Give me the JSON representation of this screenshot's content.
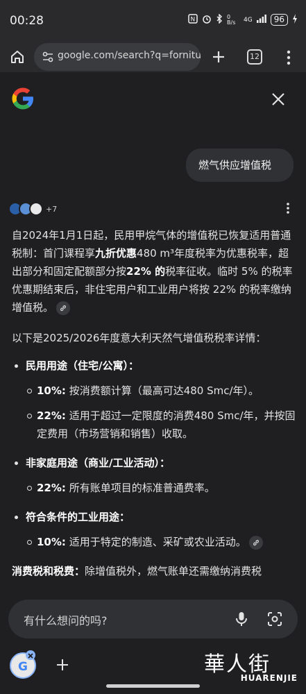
{
  "status_bar": {
    "time": "00:28",
    "net_label": "0 B/s",
    "signal": "4G",
    "battery": "96"
  },
  "browser": {
    "url": "google.com/search?q=fornitura",
    "tab_count": "12"
  },
  "query": "燃气供应增值税",
  "sources": {
    "more_count": "+7"
  },
  "answer": {
    "p1_a": "自2024年1月1日起，民用甲烷气体的增值税已恢复适用普通税制：首门课程享",
    "p1_b": "九折优惠",
    "p1_c": "480 m³年度税率为优惠税率，超出部分和固定配额部分按",
    "p1_d": "22% 的",
    "p1_e": "税率征收。临时 5% 的税率优惠期结束后，非住宅用户和工业用户将按 22% 的税率缴纳增值税。",
    "p2": "以下是2025/2026年度意大利天然气增值税税率详情：",
    "groups": [
      {
        "title": "民用用途（住宅/公寓）：",
        "items": [
          {
            "rate": "10%:",
            "text": "按消费额计算（最高可达480 Smc/年）。"
          },
          {
            "rate": "22%:",
            "text": "适用于超过一定限度的消费480 Smc/年，并按固定费用（市场营销和销售）收取。"
          }
        ]
      },
      {
        "title": "非家庭用途（商业/工业活动）：",
        "items": [
          {
            "rate": "22%:",
            "text": "所有账单项目的标准普通费率。"
          }
        ]
      },
      {
        "title": "符合条件的工业用途：",
        "items": [
          {
            "rate": "10%:",
            "text": "适用于特定的制造、采矿或农业活动。"
          }
        ]
      }
    ],
    "tax_label": "消费税和税费：",
    "tax_text": "除增值税外，燃气账单还需缴纳消费税"
  },
  "input": {
    "placeholder": "有什么想问的吗?"
  },
  "watermark": {
    "cn": "華人街",
    "en": "HUARENJIE"
  },
  "colors": {
    "background": "#1f1f21",
    "bubble": "#303134",
    "accent": "#8ab4f8"
  }
}
